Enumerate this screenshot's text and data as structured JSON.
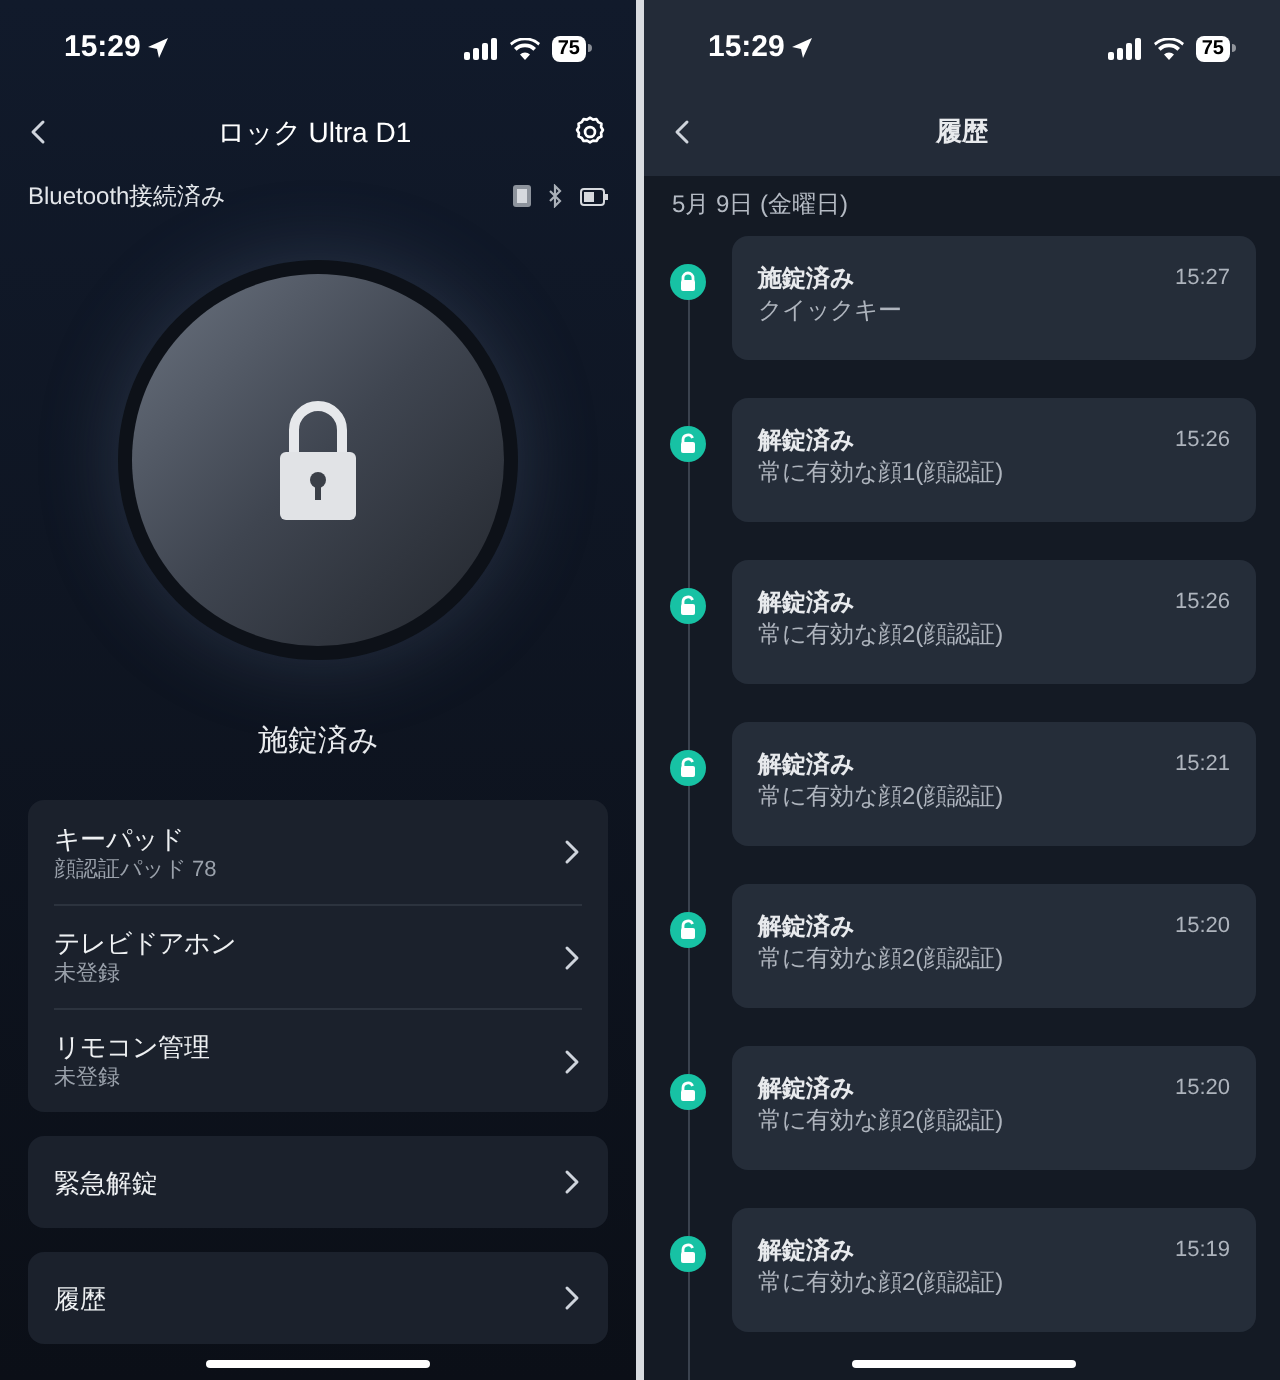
{
  "left": {
    "status_bar": {
      "time": "15:29",
      "battery": "75"
    },
    "nav": {
      "title": "ロック Ultra D1"
    },
    "connection": "Bluetooth接続済み",
    "lock": {
      "state": "施錠済み"
    },
    "menu_groups": [
      {
        "items": [
          {
            "label": "キーパッド",
            "detail": "顔認証パッド 78"
          },
          {
            "label": "テレビドアホン",
            "detail": "未登録"
          },
          {
            "label": "リモコン管理",
            "detail": "未登録"
          }
        ]
      },
      {
        "items": [
          {
            "label": "緊急解錠"
          }
        ]
      },
      {
        "items": [
          {
            "label": "履歴"
          }
        ]
      }
    ]
  },
  "right": {
    "status_bar": {
      "time": "15:29",
      "battery": "75"
    },
    "nav": {
      "title": "履歴"
    },
    "date": "5月 9日 (金曜日)",
    "events": [
      {
        "kind": "locked",
        "title": "施錠済み",
        "detail": "クイックキー",
        "time": "15:27"
      },
      {
        "kind": "unlocked",
        "title": "解錠済み",
        "detail": "常に有効な顔1(顔認証)",
        "time": "15:26"
      },
      {
        "kind": "unlocked",
        "title": "解錠済み",
        "detail": "常に有効な顔2(顔認証)",
        "time": "15:26"
      },
      {
        "kind": "unlocked",
        "title": "解錠済み",
        "detail": "常に有効な顔2(顔認証)",
        "time": "15:21"
      },
      {
        "kind": "unlocked",
        "title": "解錠済み",
        "detail": "常に有効な顔2(顔認証)",
        "time": "15:20"
      },
      {
        "kind": "unlocked",
        "title": "解錠済み",
        "detail": "常に有効な顔2(顔認証)",
        "time": "15:20"
      },
      {
        "kind": "unlocked",
        "title": "解錠済み",
        "detail": "常に有効な顔2(顔認証)",
        "time": "15:19"
      }
    ]
  }
}
